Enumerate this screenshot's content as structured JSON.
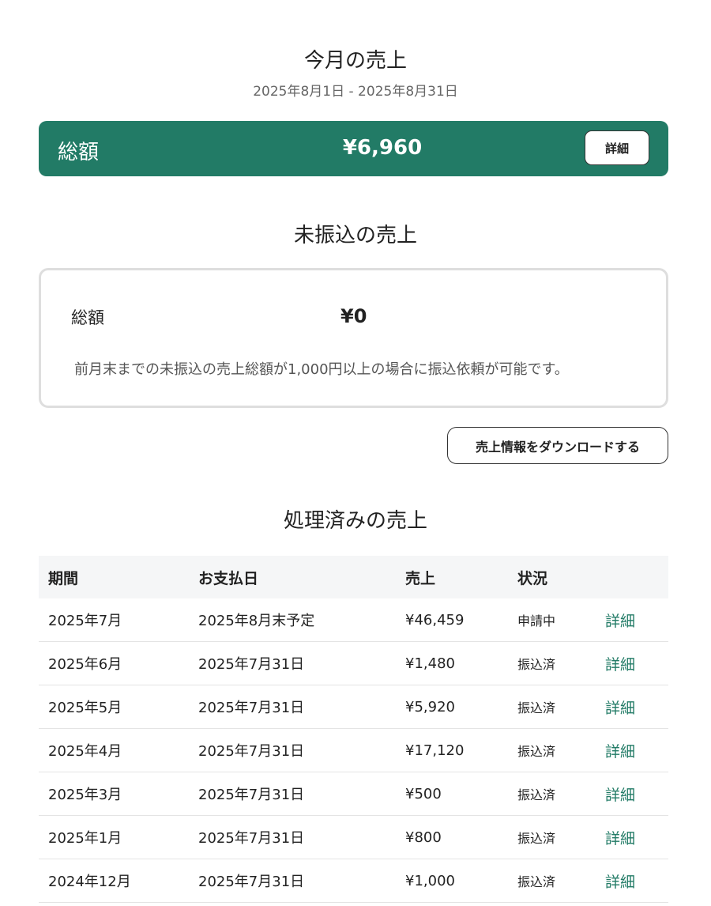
{
  "current_month": {
    "title": "今月の売上",
    "period": "2025年8月1日 - 2025年8月31日",
    "total_label": "総額",
    "total_amount": "¥6,960",
    "detail_label": "詳細"
  },
  "unpaid": {
    "title": "未振込の売上",
    "total_label": "総額",
    "total_amount": "¥0",
    "note": "前月末までの未振込の売上総額が1,000円以上の場合に振込依頼が可能です。"
  },
  "download_label": "売上情報をダウンロードする",
  "processed": {
    "title": "処理済みの売上",
    "headers": [
      "期間",
      "お支払日",
      "売上",
      "状況",
      ""
    ],
    "rows": [
      {
        "period": "2025年7月",
        "pay_date": "2025年8月末予定",
        "amount": "¥46,459",
        "status": "申請中",
        "link": "詳細"
      },
      {
        "period": "2025年6月",
        "pay_date": "2025年7月31日",
        "amount": "¥1,480",
        "status": "振込済",
        "link": "詳細"
      },
      {
        "period": "2025年5月",
        "pay_date": "2025年7月31日",
        "amount": "¥5,920",
        "status": "振込済",
        "link": "詳細"
      },
      {
        "period": "2025年4月",
        "pay_date": "2025年7月31日",
        "amount": "¥17,120",
        "status": "振込済",
        "link": "詳細"
      },
      {
        "period": "2025年3月",
        "pay_date": "2025年7月31日",
        "amount": "¥500",
        "status": "振込済",
        "link": "詳細"
      },
      {
        "period": "2025年1月",
        "pay_date": "2025年7月31日",
        "amount": "¥800",
        "status": "振込済",
        "link": "詳細"
      },
      {
        "period": "2024年12月",
        "pay_date": "2025年7月31日",
        "amount": "¥1,000",
        "status": "振込済",
        "link": "詳細"
      }
    ]
  },
  "colors": {
    "accent": "#227b66",
    "row_border": "#e4e4e4",
    "header_bg": "#f5f6f7"
  }
}
